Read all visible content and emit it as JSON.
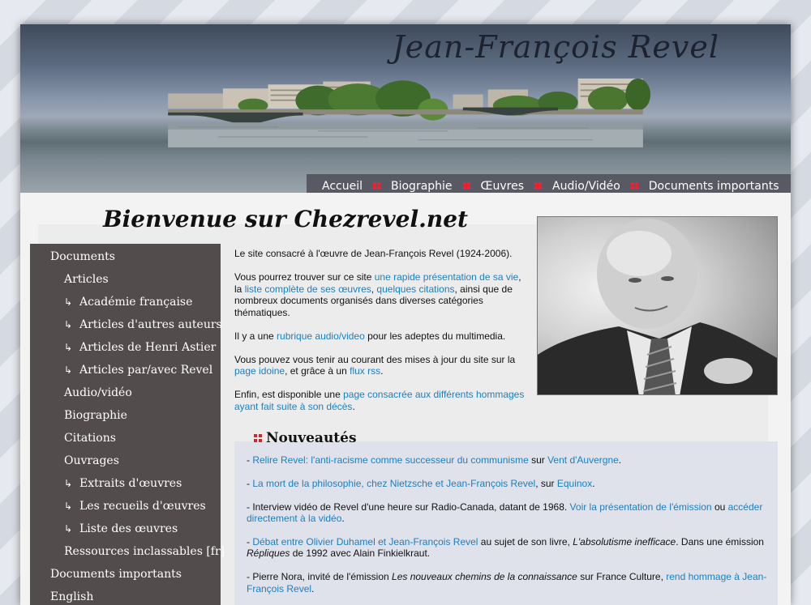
{
  "site": {
    "title": "Jean-François Revel",
    "welcome": "Bienvenue sur Chezrevel.net"
  },
  "topnav": [
    {
      "label": "Accueil"
    },
    {
      "label": "Biographie"
    },
    {
      "label": "Œuvres"
    },
    {
      "label": "Audio/Vidéo"
    },
    {
      "label": "Documents importants"
    }
  ],
  "sidebar": {
    "items": [
      {
        "label": "Documents",
        "level": 1
      },
      {
        "label": "Articles",
        "level": 2
      },
      {
        "label": "Académie française",
        "level": 3
      },
      {
        "label": "Articles d'autres auteurs",
        "level": 3
      },
      {
        "label": "Articles de Henri Astier",
        "level": 3
      },
      {
        "label": "Articles par/avec Revel",
        "level": 3
      },
      {
        "label": "Audio/vidéo",
        "level": 2
      },
      {
        "label": "Biographie",
        "level": 2
      },
      {
        "label": "Citations",
        "level": 2
      },
      {
        "label": "Ouvrages",
        "level": 2
      },
      {
        "label": "Extraits d'œuvres",
        "level": 3
      },
      {
        "label": "Les recueils d'œuvres",
        "level": 3
      },
      {
        "label": "Liste des œuvres",
        "level": 3
      },
      {
        "label": "Ressources inclassables [fr]",
        "level": 2
      },
      {
        "label": "Documents importants",
        "level": 1
      },
      {
        "label": "English",
        "level": 1
      }
    ]
  },
  "intro": {
    "p1": "Le site consacré à l'œuvre de Jean-François Revel (1924-2006).",
    "p2_a": "Vous pourrez trouver sur ce site ",
    "p2_link1": "une rapide présentation de sa vie",
    "p2_b": ",",
    "p2_c": "la ",
    "p2_link2": "liste complète de ses œuvres",
    "p2_d": ", ",
    "p2_link3": "quelques citations",
    "p2_e": ", ainsi que de nombreux documents organisés dans diverses catégories thématiques.",
    "p3_a": "Il y a une ",
    "p3_link": "rubrique audio/video",
    "p3_b": " pour les adeptes du multimedia.",
    "p4_a": "Vous pouvez vous tenir au courant des mises à jour du site sur la ",
    "p4_link1": "page idoine",
    "p4_b": ", et grâce à un ",
    "p4_link2": "flux rss",
    "p4_c": ".",
    "p5_a": "Enfin, est disponible une ",
    "p5_link": "page consacrée aux différents hommages ayant fait suite à son décès",
    "p5_b": "."
  },
  "news": {
    "title": "Nouveautés",
    "n1_a": "- ",
    "n1_link1": "Relire Revel: l'anti-racisme comme successeur du communisme",
    "n1_b": " sur ",
    "n1_link2": "Vent d'Auvergne",
    "n1_c": ".",
    "n2_a": "- ",
    "n2_link1": "La mort de la philosophie, chez Nietzsche et Jean-François Revel",
    "n2_b": ", sur ",
    "n2_link2": "Equinox",
    "n2_c": ".",
    "n3_a": "- Interview vidéo de Revel d'une heure sur Radio-Canada, datant de 1968. ",
    "n3_link1": "Voir la présentation de l'émission",
    "n3_b": " ou ",
    "n3_link2": "accéder directement à la vidéo",
    "n3_c": ".",
    "n4_a": "- ",
    "n4_link": "Débat entre Olivier Duhamel et Jean-François Revel",
    "n4_b": " au sujet de son livre, ",
    "n4_i1": "L'absolutisme inefficace",
    "n4_c": ". Dans une émission ",
    "n4_i2": "Répliques",
    "n4_d": " de 1992 avec Alain Finkielkraut.",
    "n5_a": "- Pierre Nora, invité de l'émission ",
    "n5_i": "Les nouveaux chemins de la connaissance",
    "n5_b": " sur France Culture, ",
    "n5_link": "rend hommage à Jean-François Revel",
    "n5_c": "."
  },
  "colors": {
    "link": "#1a7fc0",
    "sidebar_bg": "#524c4c",
    "nav_separator": "#e23"
  }
}
